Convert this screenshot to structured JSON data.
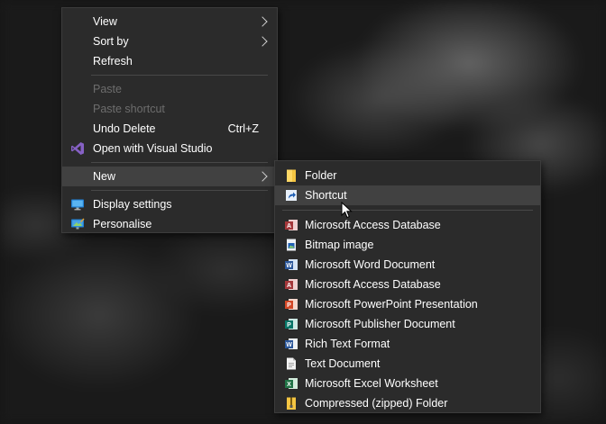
{
  "context_menu": {
    "items": [
      {
        "label": "View"
      },
      {
        "label": "Sort by"
      },
      {
        "label": "Refresh"
      },
      {
        "label": "Paste"
      },
      {
        "label": "Paste shortcut"
      },
      {
        "label": "Undo Delete",
        "shortcut": "Ctrl+Z"
      },
      {
        "label": "Open with Visual Studio",
        "icon": "visual-studio-icon"
      },
      {
        "label": "New"
      },
      {
        "label": "Display settings",
        "icon": "display-settings-icon"
      },
      {
        "label": "Personalise",
        "icon": "personalise-icon"
      }
    ]
  },
  "new_submenu": {
    "items": [
      {
        "label": "Folder",
        "icon": "folder-icon"
      },
      {
        "label": "Shortcut",
        "icon": "shortcut-icon"
      },
      {
        "label": "Microsoft Access Database",
        "icon": "access-icon"
      },
      {
        "label": "Bitmap image",
        "icon": "bitmap-icon"
      },
      {
        "label": "Microsoft Word Document",
        "icon": "word-icon"
      },
      {
        "label": "Microsoft Access Database",
        "icon": "access-icon"
      },
      {
        "label": "Microsoft PowerPoint Presentation",
        "icon": "powerpoint-icon"
      },
      {
        "label": "Microsoft Publisher Document",
        "icon": "publisher-icon"
      },
      {
        "label": "Rich Text Format",
        "icon": "rtf-icon"
      },
      {
        "label": "Text Document",
        "icon": "text-document-icon"
      },
      {
        "label": "Microsoft Excel Worksheet",
        "icon": "excel-icon"
      },
      {
        "label": "Compressed (zipped) Folder",
        "icon": "zip-folder-icon"
      }
    ]
  },
  "colors": {
    "menu_bg": "#2b2b2b",
    "hover_bg": "#414141",
    "disabled_text": "#6d6d6d",
    "visual_studio": "#8661c5",
    "folder": "#f5c542",
    "access": "#a4373a",
    "word": "#2b579a",
    "powerpoint": "#d24726",
    "publisher": "#077568",
    "excel": "#217346"
  }
}
